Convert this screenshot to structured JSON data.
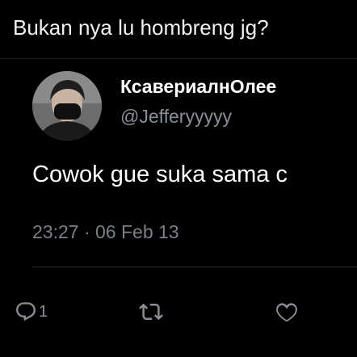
{
  "caption": "Bukan nya lu hombreng jg?",
  "tweet": {
    "display_name": "КсавериалнОлее",
    "handle": "@Jefferyyyyy",
    "text": "Cowok gue suka sama c",
    "time": "23:27",
    "separator": "·",
    "date": "06 Feb 13",
    "reply_count": "1"
  },
  "icons": {
    "reply": "reply-icon",
    "retweet": "retweet-icon",
    "like": "heart-icon"
  },
  "colors": {
    "background": "#000000",
    "text_primary": "#ffffff",
    "text_secondary": "#8a8f95"
  }
}
